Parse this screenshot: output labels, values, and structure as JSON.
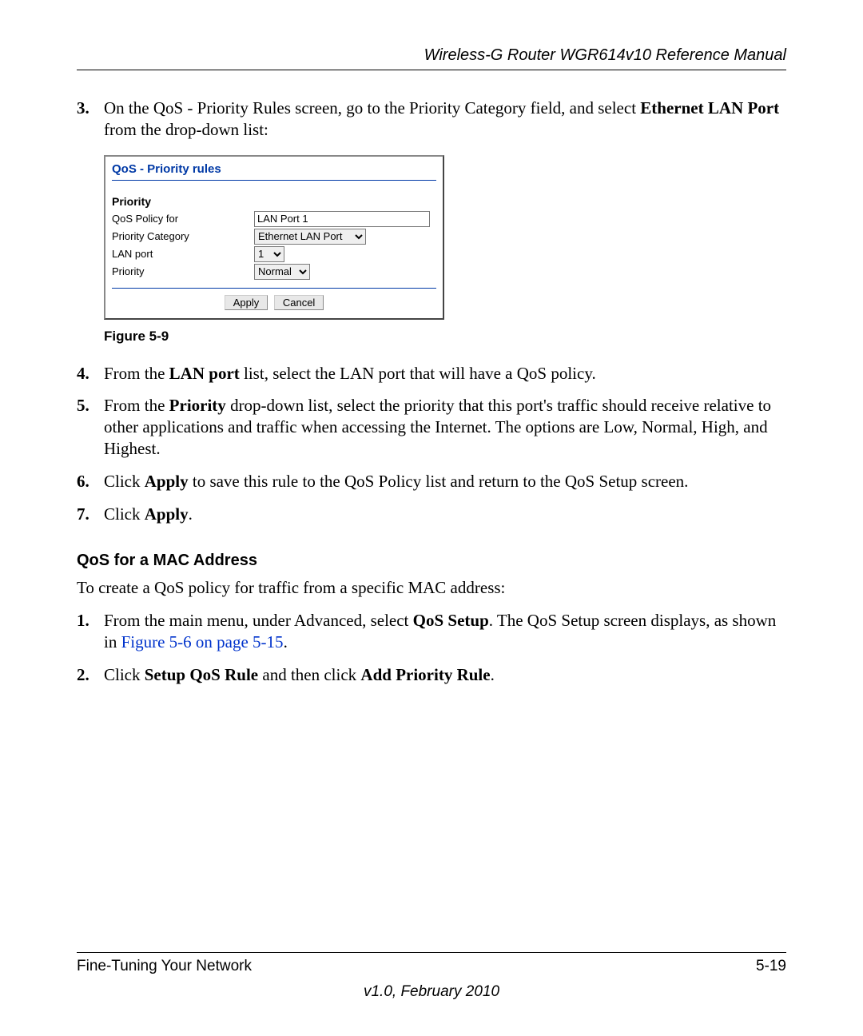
{
  "header": {
    "title": "Wireless-G Router WGR614v10 Reference Manual"
  },
  "steps_a": [
    {
      "num": "3.",
      "pre": "On the QoS - Priority Rules screen, go to the Priority Category field, and select ",
      "bold": "Ethernet LAN Port",
      "post": " from the drop-down list:"
    }
  ],
  "figure": {
    "title": "QoS - Priority rules",
    "section": "Priority",
    "rows": {
      "policy_label": "QoS Policy for",
      "policy_value": "LAN Port 1",
      "category_label": "Priority Category",
      "category_value": "Ethernet LAN Port",
      "lanport_label": "LAN port",
      "lanport_value": "1",
      "priority_label": "Priority",
      "priority_value": "Normal"
    },
    "buttons": {
      "apply": "Apply",
      "cancel": "Cancel"
    },
    "caption": "Figure 5-9"
  },
  "steps_b": [
    {
      "num": "4.",
      "parts": [
        {
          "t": "From the "
        },
        {
          "t": "LAN port",
          "b": true
        },
        {
          "t": " list, select the LAN port that will have a QoS policy."
        }
      ]
    },
    {
      "num": "5.",
      "parts": [
        {
          "t": "From the "
        },
        {
          "t": "Priority",
          "b": true
        },
        {
          "t": " drop-down list, select the priority that this port's traffic should receive relative to other applications and traffic when accessing the Internet. The options are Low, Normal, High, and Highest."
        }
      ]
    },
    {
      "num": "6.",
      "parts": [
        {
          "t": "Click "
        },
        {
          "t": "Apply",
          "b": true
        },
        {
          "t": " to save this rule to the QoS Policy list and return to the QoS Setup screen."
        }
      ]
    },
    {
      "num": "7.",
      "parts": [
        {
          "t": "Click "
        },
        {
          "t": "Apply",
          "b": true
        },
        {
          "t": "."
        }
      ]
    }
  ],
  "subheading": "QoS for a MAC Address",
  "para": "To create a QoS policy for traffic from a specific MAC address:",
  "steps_c": [
    {
      "num": "1.",
      "parts": [
        {
          "t": "From the main menu, under Advanced, select "
        },
        {
          "t": "QoS Setup",
          "b": true
        },
        {
          "t": ". The QoS Setup screen displays, as shown in "
        },
        {
          "t": "Figure 5-6 on page 5-15",
          "link": true
        },
        {
          "t": "."
        }
      ]
    },
    {
      "num": "2.",
      "parts": [
        {
          "t": "Click "
        },
        {
          "t": "Setup QoS Rule",
          "b": true
        },
        {
          "t": " and then click "
        },
        {
          "t": "Add Priority Rule",
          "b": true
        },
        {
          "t": "."
        }
      ]
    }
  ],
  "footer": {
    "left": "Fine-Tuning Your Network",
    "right": "5-19",
    "version": "v1.0, February 2010"
  }
}
